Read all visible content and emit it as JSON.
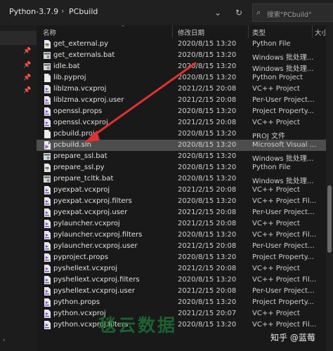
{
  "toolbar": {
    "breadcrumb": [
      "Python-3.7.9",
      "PCbuild"
    ],
    "search_placeholder": "搜索\"PCbuild\""
  },
  "columns": {
    "name": "名称",
    "date": "修改日期",
    "type": "类型",
    "size": "大小"
  },
  "files": [
    {
      "name": "get_external.py",
      "date": "2020/8/15 13:20",
      "type": "Python File",
      "icon": "python-file-icon"
    },
    {
      "name": "get_externals.bat",
      "date": "2020/8/15 13:20",
      "type": "Windows 批处理...",
      "icon": "batch-file-icon"
    },
    {
      "name": "idle.bat",
      "date": "2020/8/15 13:20",
      "type": "Windows 批处理...",
      "icon": "batch-file-icon"
    },
    {
      "name": "lib.pyproj",
      "date": "2020/8/15 13:20",
      "type": "Python Project",
      "icon": "blank-file-icon"
    },
    {
      "name": "liblzma.vcxproj",
      "date": "2021/2/15 20:08",
      "type": "VC++ Project",
      "icon": "vcxproj-icon"
    },
    {
      "name": "liblzma.vcxproj.user",
      "date": "2021/2/15 20:08",
      "type": "Per-User Project...",
      "icon": "vcxproj-icon"
    },
    {
      "name": "openssl.props",
      "date": "2020/8/15 13:20",
      "type": "Project Property...",
      "icon": "vcxproj-icon"
    },
    {
      "name": "openssl.vcxproj",
      "date": "2021/2/15 20:08",
      "type": "VC++ Project",
      "icon": "vcxproj-icon"
    },
    {
      "name": "pcbuild.proj",
      "date": "2020/8/15 13:20",
      "type": "PROJ 文件",
      "icon": "blank-file-icon"
    },
    {
      "name": "pcbuild.sln",
      "date": "2020/8/15 13:20",
      "type": "Microsoft Visual ...",
      "icon": "sln-file-icon",
      "selected": true
    },
    {
      "name": "prepare_ssl.bat",
      "date": "2020/8/15 13:20",
      "type": "Windows 批处理...",
      "icon": "batch-file-icon"
    },
    {
      "name": "prepare_ssl.py",
      "date": "2020/8/15 13:20",
      "type": "Python File",
      "icon": "python-file-icon"
    },
    {
      "name": "prepare_tcltk.bat",
      "date": "2020/8/15 13:20",
      "type": "Windows 批处理...",
      "icon": "batch-file-icon"
    },
    {
      "name": "pyexpat.vcxproj",
      "date": "2021/2/15 20:08",
      "type": "VC++ Project",
      "icon": "vcxproj-icon"
    },
    {
      "name": "pyexpat.vcxproj.filters",
      "date": "2020/8/15 13:20",
      "type": "VC++ Project Fil...",
      "icon": "vcxproj-icon"
    },
    {
      "name": "pyexpat.vcxproj.user",
      "date": "2021/2/15 20:08",
      "type": "Per-User Project...",
      "icon": "vcxproj-icon"
    },
    {
      "name": "pylauncher.vcxproj",
      "date": "2021/2/15 20:08",
      "type": "VC++ Project",
      "icon": "vcxproj-icon"
    },
    {
      "name": "pylauncher.vcxproj.filters",
      "date": "2020/8/15 13:20",
      "type": "VC++ Project Fil...",
      "icon": "vcxproj-icon"
    },
    {
      "name": "pylauncher.vcxproj.user",
      "date": "2021/2/15 20:08",
      "type": "Per-User Project...",
      "icon": "vcxproj-icon"
    },
    {
      "name": "pyproject.props",
      "date": "2020/8/15 13:20",
      "type": "Project Property...",
      "icon": "vcxproj-icon"
    },
    {
      "name": "pyshellext.vcxproj",
      "date": "2021/2/15 20:08",
      "type": "VC++ Project",
      "icon": "vcxproj-icon"
    },
    {
      "name": "pyshellext.vcxproj.filters",
      "date": "2020/8/15 13:20",
      "type": "VC++ Project Fil...",
      "icon": "vcxproj-icon"
    },
    {
      "name": "pyshellext.vcxproj.user",
      "date": "2021/2/15 20:08",
      "type": "Per-User Project...",
      "icon": "vcxproj-icon"
    },
    {
      "name": "python.props",
      "date": "2020/8/15 13:20",
      "type": "Project Property...",
      "icon": "vcxproj-icon"
    },
    {
      "name": "python.vcxproj",
      "date": "2021/2/15 20:07",
      "type": "VC++ Project",
      "icon": "vcxproj-icon"
    },
    {
      "name": "python.vcxproj.filters",
      "date": "2020/8/15 13:20",
      "type": "VC++ Project Fil...",
      "icon": "vcxproj-icon"
    }
  ],
  "watermarks": {
    "brand": "毯云数据",
    "author": "知乎 @蓝莓"
  },
  "colors": {
    "arrow": "#e03131",
    "selection": "#4d4d4d",
    "background": "#191919"
  }
}
